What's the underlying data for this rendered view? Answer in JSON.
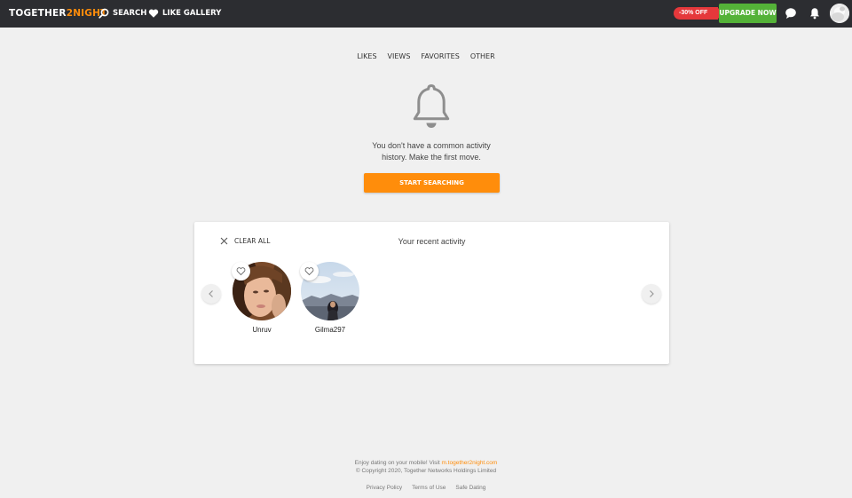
{
  "header": {
    "logo_main": "TOGETHER",
    "logo_accent": "2NIGHT",
    "nav": [
      {
        "label": "SEARCH",
        "icon": "search-icon"
      },
      {
        "label": "LIKE GALLERY",
        "icon": "heart-icon"
      }
    ],
    "discount_label": "-30% OFF",
    "upgrade_label": "UPGRADE NOW",
    "icons": [
      "chat-icon",
      "bell-icon",
      "avatar"
    ]
  },
  "tabs": [
    "LIKES",
    "VIEWS",
    "FAVORITES",
    "OTHER"
  ],
  "empty_state": {
    "icon": "bell-icon",
    "line1": "You don't have a common activity",
    "line2": "history. Make the first move.",
    "button_label": "START SEARCHING"
  },
  "recent": {
    "clear_label": "CLEAR ALL",
    "title": "Your recent activity",
    "profiles": [
      {
        "name": "Unruv"
      },
      {
        "name": "Gilma297"
      }
    ]
  },
  "footer": {
    "mobile_text": "Enjoy dating on your mobile! Visit ",
    "mobile_link": "m.together2night.com",
    "copyright": "© Copyright 2020, Together Networks Holdings Limited",
    "links": [
      "Privacy Policy",
      "Terms of Use",
      "Safe Dating"
    ]
  },
  "colors": {
    "topbar": "#2c2d31",
    "accent_orange": "#ff8d0b",
    "upgrade_green": "#54b238",
    "discount_red": "#e5383b",
    "page_bg": "#f0f0f0"
  }
}
